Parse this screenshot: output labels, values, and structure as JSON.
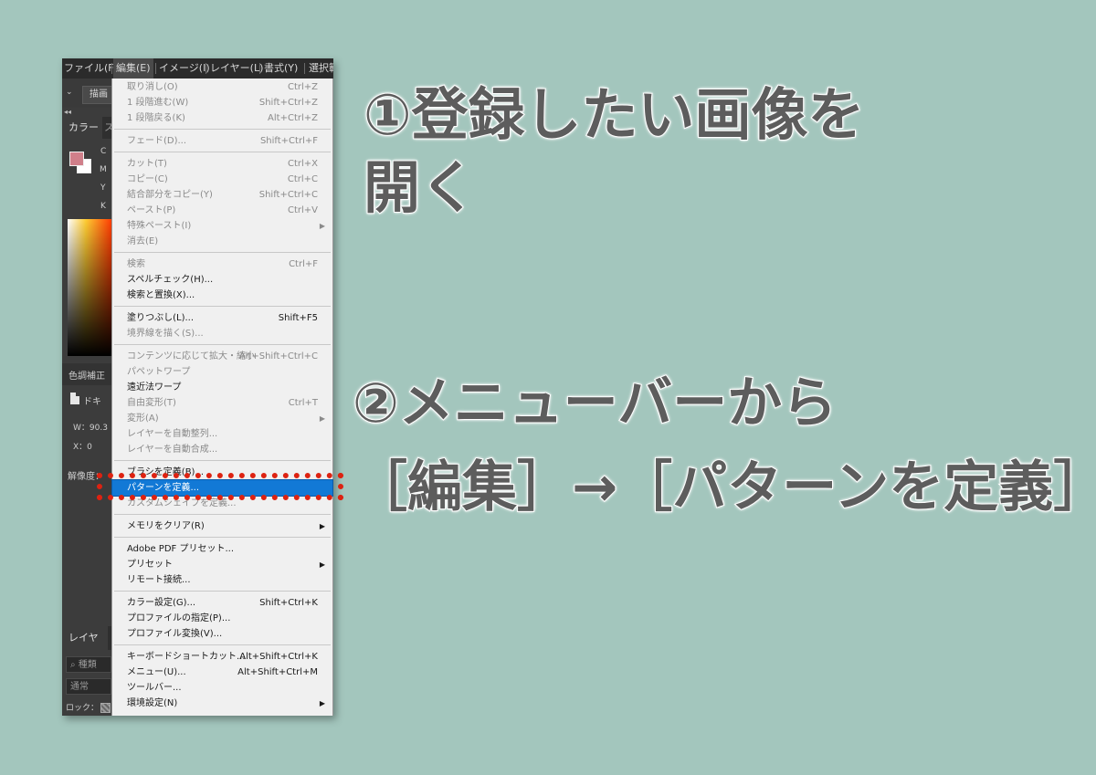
{
  "menubar": [
    "ファイル(F)",
    "編集(E)",
    "イメージ(I)",
    "レイヤー(L)",
    "書式(Y)",
    "選択範"
  ],
  "optbar": {
    "dropdown": "⌄",
    "button": "描画"
  },
  "panel_tabs": {
    "color": "カラー",
    "swatches": "ス"
  },
  "color_channels": [
    "C",
    "M",
    "Y",
    "K"
  ],
  "side_panel": {
    "adjustments": "色調補正",
    "document": "ドキ",
    "w_label": "W：90.3",
    "x_label": "X：0",
    "resolution": "解像度：",
    "layers_tab": "レイヤー",
    "layer_search": "種類",
    "blend_mode": "通常",
    "lock": "ロック："
  },
  "colors": {
    "foreground": "#d07f8a",
    "background": "#ffffff",
    "accent": "#1279d6",
    "callout": "#dd2211"
  },
  "menu": [
    {
      "label": "取り消し(O)",
      "shortcut": "Ctrl+Z",
      "disabled": true
    },
    {
      "label": "1 段階進む(W)",
      "shortcut": "Shift+Ctrl+Z",
      "disabled": true
    },
    {
      "label": "1 段階戻る(K)",
      "shortcut": "Alt+Ctrl+Z",
      "disabled": true
    },
    {
      "sep": true
    },
    {
      "label": "フェード(D)...",
      "shortcut": "Shift+Ctrl+F",
      "disabled": true
    },
    {
      "sep": true
    },
    {
      "label": "カット(T)",
      "shortcut": "Ctrl+X",
      "disabled": true
    },
    {
      "label": "コピー(C)",
      "shortcut": "Ctrl+C",
      "disabled": true
    },
    {
      "label": "結合部分をコピー(Y)",
      "shortcut": "Shift+Ctrl+C",
      "disabled": true
    },
    {
      "label": "ペースト(P)",
      "shortcut": "Ctrl+V",
      "disabled": true
    },
    {
      "label": "特殊ペースト(I)",
      "shortcut": "",
      "disabled": true,
      "arrow": true
    },
    {
      "label": "消去(E)",
      "shortcut": "",
      "disabled": true
    },
    {
      "sep": true
    },
    {
      "label": "検索",
      "shortcut": "Ctrl+F",
      "disabled": true
    },
    {
      "label": "スペルチェック(H)...",
      "shortcut": ""
    },
    {
      "label": "検索と置換(X)...",
      "shortcut": ""
    },
    {
      "sep": true
    },
    {
      "label": "塗りつぶし(L)...",
      "shortcut": "Shift+F5"
    },
    {
      "label": "境界線を描く(S)...",
      "shortcut": "",
      "disabled": true
    },
    {
      "sep": true
    },
    {
      "label": "コンテンツに応じて拡大・縮小",
      "shortcut": "Alt+Shift+Ctrl+C",
      "disabled": true
    },
    {
      "label": "パペットワープ",
      "shortcut": "",
      "disabled": true
    },
    {
      "label": "遠近法ワープ",
      "shortcut": ""
    },
    {
      "label": "自由変形(T)",
      "shortcut": "Ctrl+T",
      "disabled": true
    },
    {
      "label": "変形(A)",
      "shortcut": "",
      "disabled": true,
      "arrow": true
    },
    {
      "label": "レイヤーを自動整列...",
      "shortcut": "",
      "disabled": true
    },
    {
      "label": "レイヤーを自動合成...",
      "shortcut": "",
      "disabled": true
    },
    {
      "sep": true
    },
    {
      "label": "ブラシを定義(B)...",
      "shortcut": ""
    },
    {
      "label": "パターンを定義...",
      "shortcut": "",
      "highlighted": true
    },
    {
      "label": "カスタムシェイプを定義...",
      "shortcut": "",
      "disabled": true
    },
    {
      "sep": true
    },
    {
      "label": "メモリをクリア(R)",
      "shortcut": "",
      "arrow": true
    },
    {
      "sep": true
    },
    {
      "label": "Adobe PDF プリセット...",
      "shortcut": ""
    },
    {
      "label": "プリセット",
      "shortcut": "",
      "arrow": true
    },
    {
      "label": "リモート接続...",
      "shortcut": ""
    },
    {
      "sep": true
    },
    {
      "label": "カラー設定(G)...",
      "shortcut": "Shift+Ctrl+K"
    },
    {
      "label": "プロファイルの指定(P)...",
      "shortcut": ""
    },
    {
      "label": "プロファイル変換(V)...",
      "shortcut": ""
    },
    {
      "sep": true
    },
    {
      "label": "キーボードショートカット...",
      "shortcut": "Alt+Shift+Ctrl+K"
    },
    {
      "label": "メニュー(U)...",
      "shortcut": "Alt+Shift+Ctrl+M"
    },
    {
      "label": "ツールバー...",
      "shortcut": ""
    },
    {
      "label": "環境設定(N)",
      "shortcut": "",
      "arrow": true
    }
  ],
  "annotations": {
    "step1_line1": "①登録したい画像を",
    "step1_line2": "開く",
    "step2_line1": "②メニューバーから",
    "step2_line2": "［編集］→［パターンを定義］"
  }
}
